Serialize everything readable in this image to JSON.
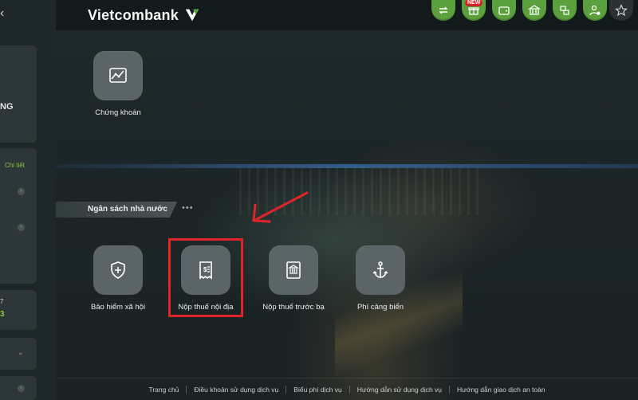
{
  "header": {
    "logo_text": "Vietcombank",
    "new_badge": "NEW",
    "icons": [
      "transfer-icon",
      "gift-icon",
      "wallet-icon",
      "bank-icon",
      "exchange-icon",
      "user-settings-icon",
      "star-icon"
    ],
    "accent_color": "#5aa03c"
  },
  "sidebar": {
    "back_glyph": "‹",
    "card_label": "NG",
    "detail_link": "Chi tiết",
    "num_seven": "7",
    "num_three": "3"
  },
  "top_tiles": [
    {
      "label": "Chứng khoán",
      "icon": "stock-chart-icon"
    }
  ],
  "section": {
    "title": "Ngân sách nhà nước",
    "dots": "•••"
  },
  "tiles": [
    {
      "label": "Bảo hiểm xã hội",
      "icon": "shield-plus-icon"
    },
    {
      "label": "Nộp thuế nội địa",
      "icon": "tax-receipt-icon"
    },
    {
      "label": "Nộp thuế trước bạ",
      "icon": "building-document-icon"
    },
    {
      "label": "Phí cảng biển",
      "icon": "anchor-icon"
    }
  ],
  "annotation": {
    "highlight_color": "#e0252a"
  },
  "footer": {
    "links": [
      "Trang chủ",
      "Điều khoản sử dụng dịch vụ",
      "Biểu phí dịch vụ",
      "Hướng dẫn sử dụng dịch vụ",
      "Hướng dẫn giao dịch an toàn"
    ]
  }
}
